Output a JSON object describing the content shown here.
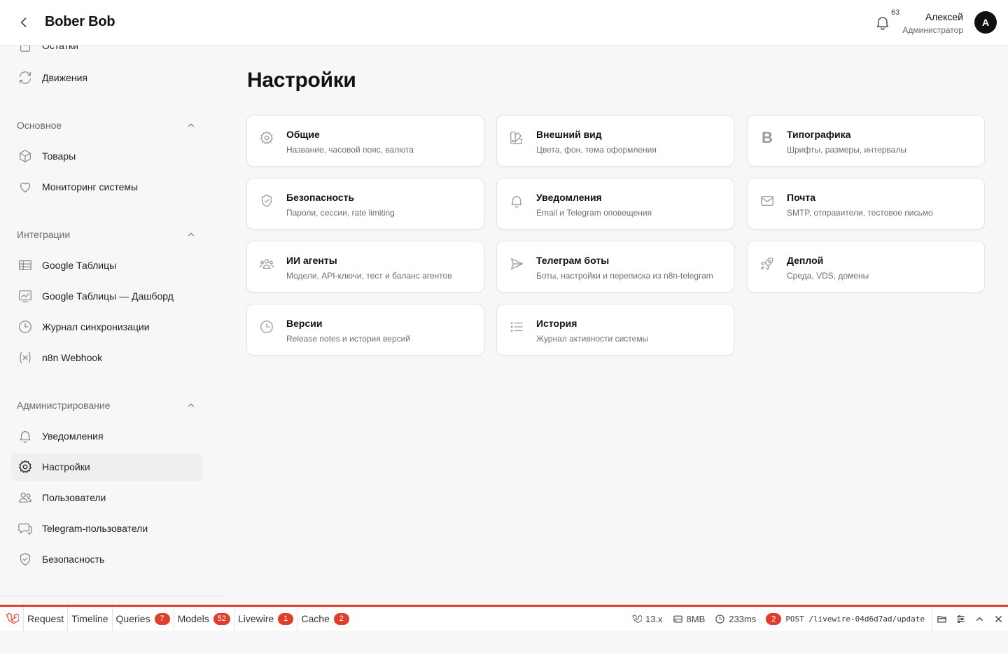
{
  "header": {
    "brand": "Bober Bob",
    "notification_count": "63",
    "user_name": "Алексей",
    "user_role": "Администратор",
    "avatar_letter": "А"
  },
  "sidebar": {
    "top_items": [
      {
        "label": "Остатки",
        "icon": "clipboard-icon"
      },
      {
        "label": "Движения",
        "icon": "refresh-icon"
      }
    ],
    "groups": [
      {
        "label": "Основное",
        "items": [
          {
            "label": "Товары",
            "icon": "cube-icon"
          },
          {
            "label": "Мониторинг системы",
            "icon": "heart-icon"
          }
        ]
      },
      {
        "label": "Интеграции",
        "items": [
          {
            "label": "Google Таблицы",
            "icon": "table-icon"
          },
          {
            "label": "Google Таблицы — Дашборд",
            "icon": "chart-icon"
          },
          {
            "label": "Журнал синхронизации",
            "icon": "clock-icon"
          },
          {
            "label": "n8n Webhook",
            "icon": "variable-icon"
          }
        ]
      },
      {
        "label": "Администрирование",
        "items": [
          {
            "label": "Уведомления",
            "icon": "bell-icon"
          },
          {
            "label": "Настройки",
            "icon": "gear-icon",
            "active": true
          },
          {
            "label": "Пользователи",
            "icon": "users-icon"
          },
          {
            "label": "Telegram-пользователи",
            "icon": "chat-icon"
          },
          {
            "label": "Безопасность",
            "icon": "shield-icon"
          }
        ]
      }
    ]
  },
  "main": {
    "title": "Настройки",
    "cards": [
      {
        "title": "Общие",
        "desc": "Название, часовой пояс, валюта",
        "icon": "gear-icon"
      },
      {
        "title": "Внешний вид",
        "desc": "Цвета, фон, тема оформления",
        "icon": "swatch-icon"
      },
      {
        "title": "Типографика",
        "desc": "Шрифты, размеры, интервалы",
        "icon": "bold-icon",
        "icon_text": "B"
      },
      {
        "title": "Безопасность",
        "desc": "Пароли, сессии, rate limiting",
        "icon": "shield-icon"
      },
      {
        "title": "Уведомления",
        "desc": "Email и Telegram оповещения",
        "icon": "bell-icon"
      },
      {
        "title": "Почта",
        "desc": "SMTP, отправители, тестовое письмо",
        "icon": "envelope-icon"
      },
      {
        "title": "ИИ агенты",
        "desc": "Модели, API-ключи, тест и баланс агентов",
        "icon": "user-group-icon"
      },
      {
        "title": "Телеграм боты",
        "desc": "Боты, настройки и переписка из n8n-telegram",
        "icon": "paper-plane-icon"
      },
      {
        "title": "Деплой",
        "desc": "Среда, VDS, домены",
        "icon": "rocket-icon"
      },
      {
        "title": "Версии",
        "desc": "Release notes и история версий",
        "icon": "clock-icon"
      },
      {
        "title": "История",
        "desc": "Журнал активности системы",
        "icon": "list-icon"
      }
    ]
  },
  "debugbar": {
    "tabs": [
      {
        "label": "Request"
      },
      {
        "label": "Timeline"
      },
      {
        "label": "Queries",
        "badge": "7"
      },
      {
        "label": "Models",
        "badge": "52"
      },
      {
        "label": "Livewire",
        "badge": "1"
      },
      {
        "label": "Cache",
        "badge": "2"
      }
    ],
    "version": "13.x",
    "memory": "8MB",
    "time": "233ms",
    "route_badge": "2",
    "route": "POST /livewire-04d6d7ad/update",
    "accent": "#e03e2d"
  }
}
